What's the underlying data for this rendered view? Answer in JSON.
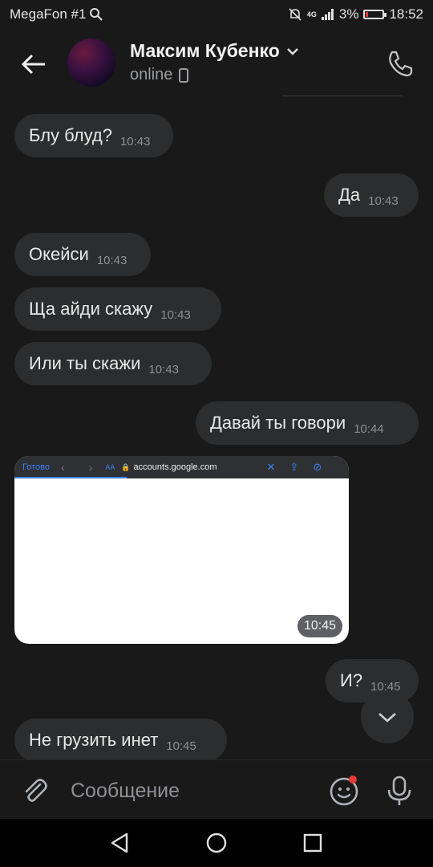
{
  "status_bar": {
    "carrier": "MegaFon #1",
    "network": "4G",
    "battery": "3%",
    "time": "18:52"
  },
  "header": {
    "contact_name": "Максим Кубенко",
    "status": "online"
  },
  "messages": [
    {
      "dir": "in",
      "text": "Блу блуд?",
      "time": "10:43"
    },
    {
      "dir": "out",
      "text": "Да",
      "time": "10:43"
    },
    {
      "dir": "in",
      "text": "Окейси",
      "time": "10:43"
    },
    {
      "dir": "in",
      "text": "Ща айди скажу",
      "time": "10:43"
    },
    {
      "dir": "in",
      "text": "Или ты скажи",
      "time": "10:43"
    },
    {
      "dir": "out",
      "text": "Давай ты говори",
      "time": "10:44"
    },
    {
      "dir": "out",
      "text": "И?",
      "time": "10:45"
    },
    {
      "dir": "in",
      "text": "Не грузить инет",
      "time": "10:45"
    }
  ],
  "screenshot_message": {
    "time": "10:45",
    "browser_done": "Готово",
    "text_size": "AA",
    "url": "accounts.google.com"
  },
  "composer": {
    "placeholder": "Сообщение"
  },
  "colors": {
    "background": "#191919",
    "bubble": "#2c2d2e",
    "accent_red": "#e53935",
    "link_blue": "#3b82f6"
  }
}
